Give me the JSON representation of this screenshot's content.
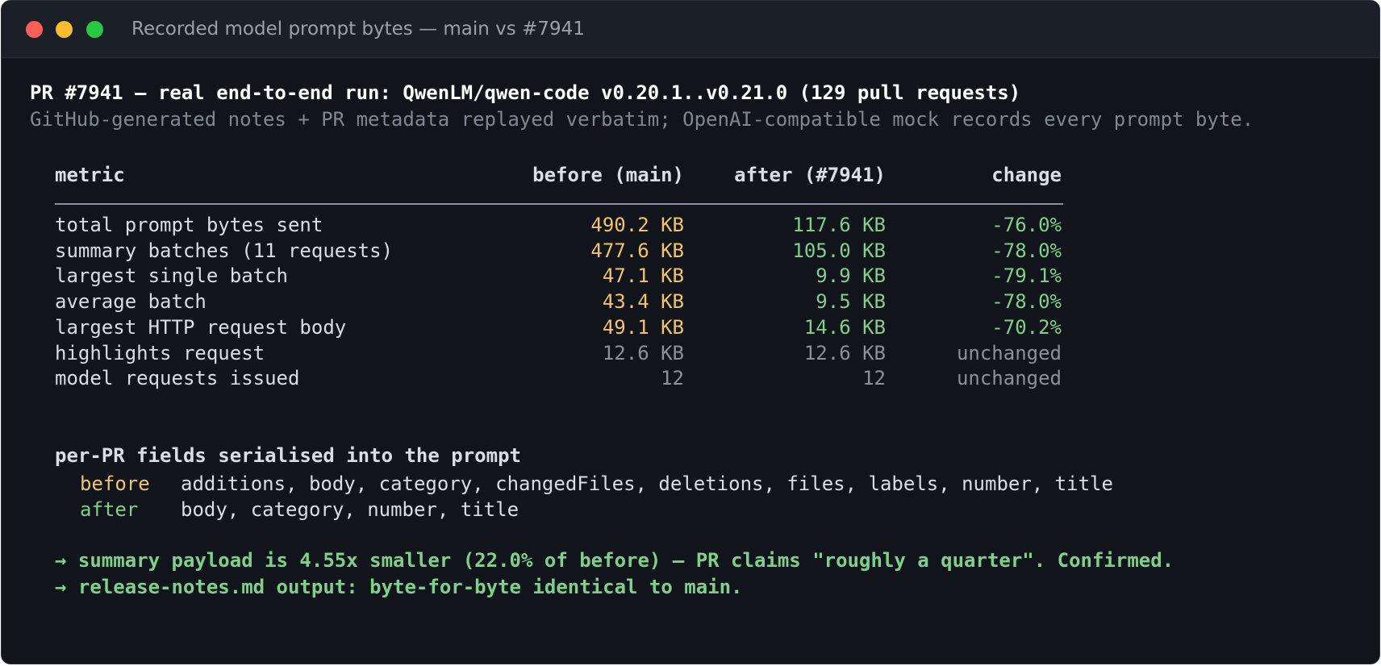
{
  "window": {
    "title": "Recorded model prompt bytes — main vs #7941"
  },
  "header": {
    "title": "PR #7941 — real end-to-end run: QwenLM/qwen-code v0.20.1..v0.21.0 (129 pull requests)",
    "subtitle": "GitHub-generated notes + PR metadata replayed verbatim; OpenAI-compatible mock records every prompt byte."
  },
  "table": {
    "headers": {
      "metric": "metric",
      "before": "before (main)",
      "after": "after (#7941)",
      "change": "change"
    },
    "rows": [
      {
        "metric": "total prompt bytes sent",
        "before": "490.2 KB",
        "after": "117.6 KB",
        "change": "-76.0%",
        "style": "changed"
      },
      {
        "metric": "summary batches (11 requests)",
        "before": "477.6 KB",
        "after": "105.0 KB",
        "change": "-78.0%",
        "style": "changed"
      },
      {
        "metric": "largest single batch",
        "before": "47.1 KB",
        "after": "9.9 KB",
        "change": "-79.1%",
        "style": "changed"
      },
      {
        "metric": "average batch",
        "before": "43.4 KB",
        "after": "9.5 KB",
        "change": "-78.0%",
        "style": "changed"
      },
      {
        "metric": "largest HTTP request body",
        "before": "49.1 KB",
        "after": "14.6 KB",
        "change": "-70.2%",
        "style": "changed"
      },
      {
        "metric": "highlights request",
        "before": "12.6 KB",
        "after": "12.6 KB",
        "change": "unchanged",
        "style": "unchanged"
      },
      {
        "metric": "model requests issued",
        "before": "12",
        "after": "12",
        "change": "unchanged",
        "style": "unchanged"
      }
    ]
  },
  "fields": {
    "title": "per-PR fields serialised into the prompt",
    "before_label": "before",
    "before_value": "additions, body, category, changedFiles, deletions, files, labels, number, title",
    "after_label": "after",
    "after_value": "body, category, number, title"
  },
  "conclusions": [
    "→ summary payload is 4.55x smaller (22.0% of before) — PR claims \"roughly a quarter\". Confirmed.",
    "→ release-notes.md output: byte-for-byte identical to main."
  ],
  "colors": {
    "background": "#11141b",
    "titlebar": "#1b1f28",
    "before_value": "#f0c46c",
    "after_value": "#7fd08a",
    "unchanged": "#8a919c"
  }
}
